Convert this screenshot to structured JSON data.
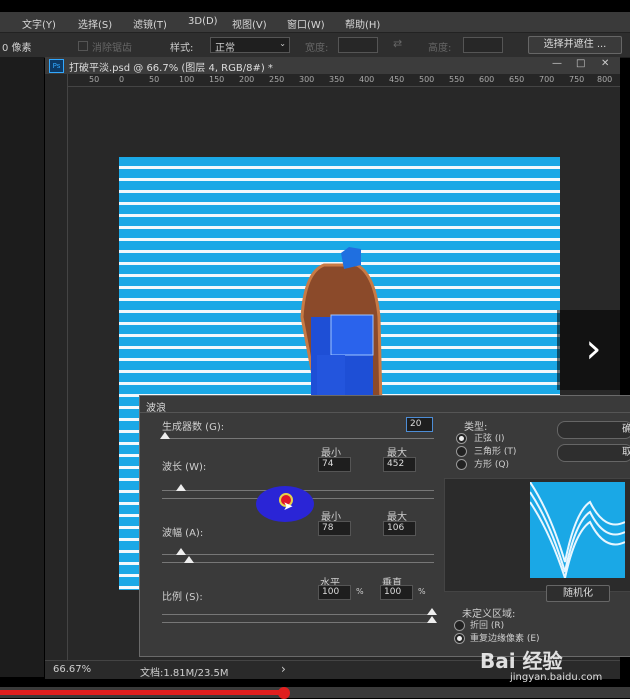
{
  "menu": {
    "items": [
      "文字(Y)",
      "选择(S)",
      "滤镜(T)",
      "3D(D)",
      "视图(V)",
      "窗口(W)",
      "帮助(H)"
    ]
  },
  "options_bar": {
    "unit_label": "0 像素",
    "antialias_label": "消除锯齿",
    "style_label": "样式:",
    "style_value": "正常",
    "width_label": "宽度:",
    "height_label": "高度:",
    "select_mask_button": "选择并遮住 ..."
  },
  "document": {
    "tab_title": "打破平淡.psd @ 66.7% (图层 4, RGB/8#) *",
    "ps_badge": "Ps",
    "ruler_ticks": [
      "50",
      "0",
      "50",
      "100",
      "150",
      "200",
      "250",
      "300",
      "350",
      "400",
      "450",
      "500",
      "550",
      "600",
      "650",
      "700",
      "750",
      "800",
      "850"
    ],
    "window_controls": [
      "—",
      "□",
      "✕"
    ]
  },
  "status": {
    "zoom": "66.67%",
    "doc_size": "文档:1.81M/23.5M",
    "arrow": "›"
  },
  "wave_dialog": {
    "title": "波浪",
    "generators_label": "生成器数 (G):",
    "generators_value": "20",
    "wavelength_label": "波长 (W):",
    "wavelength_min_label": "最小",
    "wavelength_max_label": "最大",
    "wavelength_min": "74",
    "wavelength_max": "452",
    "amplitude_label": "波幅 (A):",
    "amplitude_min_label": "最小",
    "amplitude_max_label": "最大",
    "amplitude_min": "78",
    "amplitude_max": "106",
    "scale_label": "比例 (S):",
    "scale_h_label": "水平",
    "scale_v_label": "垂直",
    "scale_h": "100",
    "scale_v": "100",
    "percent": "%",
    "type_label": "类型:",
    "type_options": [
      "正弦 (I)",
      "三角形 (T)",
      "方形 (Q)"
    ],
    "type_selected": 0,
    "ok_button": "确",
    "cancel_button": "取",
    "randomize_button": "随机化",
    "undefined_area_label": "未定义区域:",
    "undefined_options": [
      "折回 (R)",
      "重复边缘像素 (E)"
    ],
    "undefined_selected": 1
  },
  "watermark": {
    "logo": "Bai 经验",
    "url": "jingyan.baidu.com"
  },
  "video": {
    "next_arrow": "›",
    "progress_fraction": 0.45
  },
  "colors": {
    "canvas_blue": "#1aa8e6",
    "stripe_white": "#f2f8fc",
    "highlight_blue": "#2a25d6",
    "progress_red": "#e01f1f"
  }
}
